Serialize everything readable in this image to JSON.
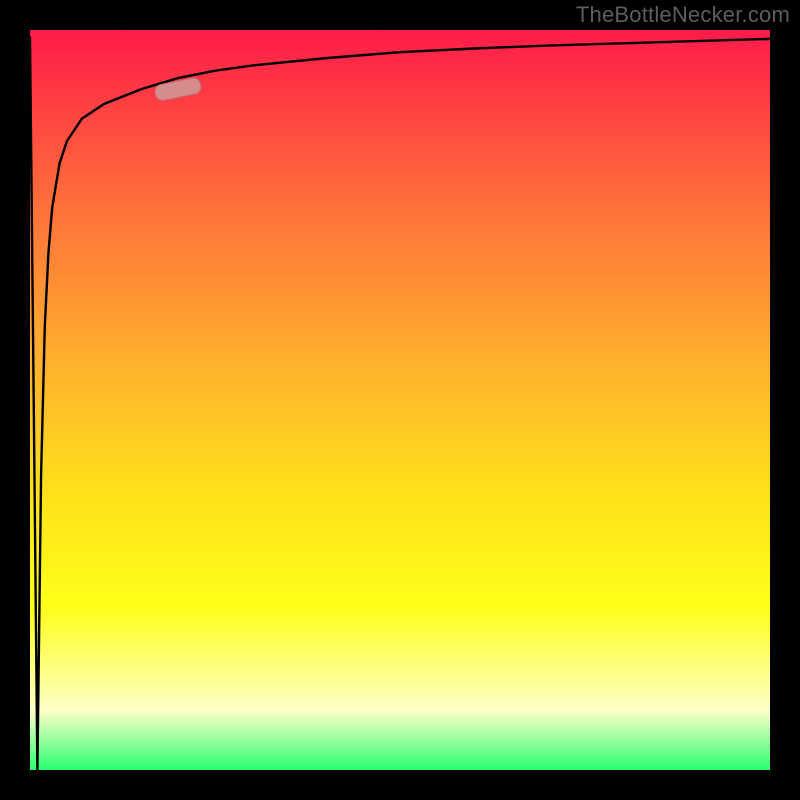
{
  "watermark": "TheBottleNecker.com",
  "colors": {
    "background": "#000000",
    "curve": "#000000",
    "marker_fill": "#cf9a9a",
    "marker_stroke": "#b27d7d",
    "gradient_stops": [
      "#ff1b49",
      "#ff6a3b",
      "#ffb12e",
      "#ffe21a",
      "#ffff1a",
      "#fcffc7",
      "#2bff71"
    ]
  },
  "chart_data": {
    "type": "line",
    "title": "",
    "xlabel": "",
    "ylabel": "",
    "xlim": [
      0,
      100
    ],
    "ylim": [
      0,
      100
    ],
    "x": [
      0,
      0.5,
      1,
      1.5,
      2,
      2.5,
      3,
      4,
      5,
      7,
      10,
      15,
      20,
      25,
      30,
      40,
      50,
      60,
      70,
      80,
      90,
      100
    ],
    "y": [
      99,
      50,
      0,
      40,
      60,
      70,
      76,
      82,
      85,
      88,
      90,
      92,
      93.5,
      94.5,
      95.2,
      96.2,
      97,
      97.5,
      97.9,
      98.2,
      98.5,
      98.8
    ],
    "marker": {
      "x_pct": 20,
      "y_pct": 92
    },
    "note": "Values are percentages of the plot area; y is measured from the bottom. Curve shape estimated from pixels."
  }
}
